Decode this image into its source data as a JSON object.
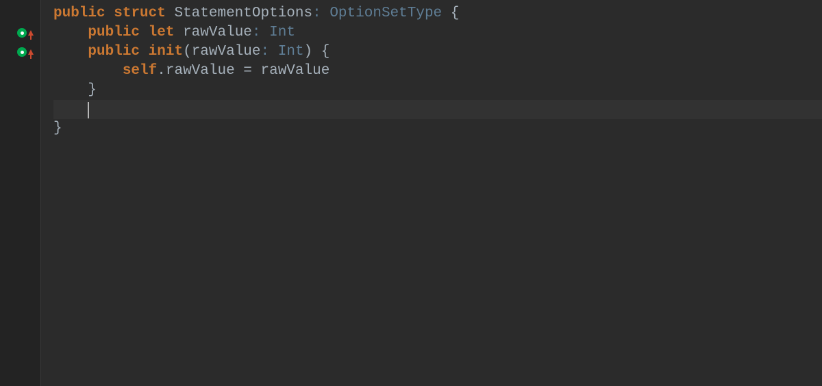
{
  "gutter": {
    "markers": [
      {
        "line": 2,
        "type": "error-up"
      },
      {
        "line": 3,
        "type": "error-up"
      }
    ]
  },
  "code": {
    "line1": {
      "kw1": "public",
      "kw2": "struct",
      "name": "StatementOptions",
      "colon": ":",
      "type": "OptionSetType",
      "brace": " {"
    },
    "line2": {
      "kw1": "public",
      "kw2": "let",
      "name": "rawValue",
      "colon": ":",
      "type": "Int"
    },
    "line3": {
      "kw1": "public",
      "kw2": "init",
      "lparen": "(",
      "param": "rawValue",
      "colon": ":",
      "type": "Int",
      "rparen": ")",
      "brace": " {"
    },
    "line4": {
      "kwself": "self",
      "dot": ".",
      "prop": "rawValue",
      "eq": " = ",
      "val": "rawValue"
    },
    "line5": {
      "brace": "}"
    },
    "line6_indent": "    ",
    "line7": {
      "brace": "}"
    }
  },
  "colors": {
    "background": "#2b2b2b",
    "gutter_bg": "#232323",
    "keyword": "#cb7832",
    "identifier": "#a6b1bb",
    "type": "#5f7e96",
    "current_line": "#323232",
    "error_marker": "#00a84f",
    "arrow": "#cc4a2f"
  }
}
